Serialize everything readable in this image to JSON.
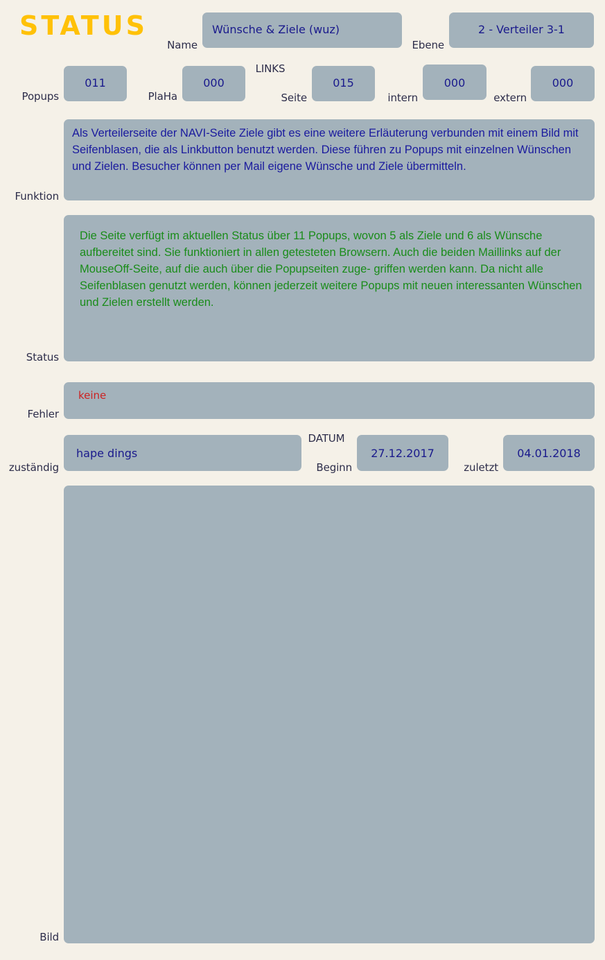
{
  "header": {
    "title": "STATUS",
    "title_color": "#FFC107",
    "name_label": "Name",
    "name_value": "Wünsche & Ziele (wuz)",
    "ebene_label": "Ebene",
    "ebene_value": "2 - Verteiler 3-1"
  },
  "counters": {
    "links_heading": "LINKS",
    "popups_label": "Popups",
    "popups_value": "011",
    "plaha_label": "PlaHa",
    "plaha_value": "000",
    "seite_label": "Seite",
    "seite_value": "015",
    "intern_label": "intern",
    "intern_value": "000",
    "extern_label": "extern",
    "extern_value": "000"
  },
  "funktion": {
    "label": "Funktion",
    "text": "Als Verteilerseite der NAVI-Seite Ziele gibt es eine weitere Erläuterung verbunden mit einem Bild mit Seifenblasen, die als Linkbutton benutzt werden. Diese führen zu Popups mit einzelnen Wünschen und Zielen. Besucher können per Mail eigene Wünsche und Ziele übermitteln."
  },
  "status": {
    "label": "Status",
    "text": "Die Seite verfügt im aktuellen Status über 11 Popups, wovon 5 als Ziele und 6 als Wünsche aufbereitet sind. Sie funktioniert in allen getesteten Browsern. Auch die beiden Maillinks auf der MouseOff-Seite, auf die auch über die Popupseiten zuge- griffen werden kann. Da nicht alle Seifenblasen genutzt werden, können jederzeit weitere Popups mit neuen interessanten Wünschen und Zielen erstellt werden."
  },
  "fehler": {
    "label": "Fehler",
    "value": "keine",
    "value_color": "#CC2222"
  },
  "zustaendig": {
    "label": "zuständig",
    "value": "hape dings"
  },
  "datum": {
    "heading": "DATUM",
    "beginn_label": "Beginn",
    "beginn_value": "27.12.2017",
    "zuletzt_label": "zuletzt",
    "zuletzt_value": "04.01.2018"
  },
  "bild": {
    "label": "Bild",
    "content": ""
  },
  "theme": {
    "background": "#F5F1E8",
    "box_fill": "#A3B2BB",
    "label_color": "#2D2D4A",
    "value_color": "#1A1A8C",
    "status_text_color": "#1A8C1A",
    "funktion_text_color": "#1A1A9E"
  }
}
